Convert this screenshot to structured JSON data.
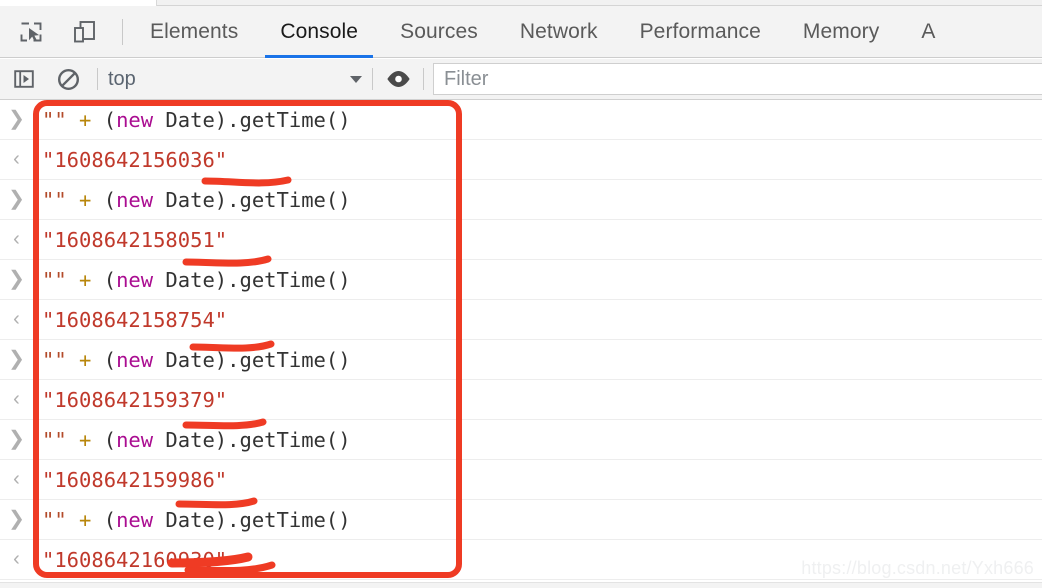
{
  "window": {
    "app": "Chrome DevTools",
    "theme_bg": "#f3f3f3",
    "accent": "#1a73e8",
    "annotation_color": "#ef3b24"
  },
  "toolbar": {
    "inspect_icon": "inspect-element-icon",
    "device_icon": "device-toolbar-icon",
    "tabs": [
      {
        "label": "Elements",
        "active": false
      },
      {
        "label": "Console",
        "active": true
      },
      {
        "label": "Sources",
        "active": false
      },
      {
        "label": "Network",
        "active": false
      },
      {
        "label": "Performance",
        "active": false
      },
      {
        "label": "Memory",
        "active": false
      },
      {
        "label": "A",
        "active": false
      }
    ]
  },
  "console_toolbar": {
    "sidebar_toggle_icon": "console-sidebar-toggle-icon",
    "clear_icon": "clear-console-icon",
    "context": {
      "value": "top",
      "chevron": "chevron-down-icon"
    },
    "eye_icon": "live-expression-eye-icon",
    "filter": {
      "value": "",
      "placeholder": "Filter"
    }
  },
  "console": {
    "input_marker": "❯",
    "output_marker": "‹",
    "entries": [
      {
        "type": "input",
        "expression": {
          "string": "\"\"",
          "plus": "+",
          "open_paren": "(",
          "keyword": "new",
          "rest": " Date).getTime()"
        }
      },
      {
        "type": "output",
        "value": "\"1608642156036\"",
        "number": "1608642156036"
      },
      {
        "type": "input",
        "expression": {
          "string": "\"\"",
          "plus": "+",
          "open_paren": "(",
          "keyword": "new",
          "rest": " Date).getTime()"
        }
      },
      {
        "type": "output",
        "value": "\"1608642158051\"",
        "number": "1608642158051"
      },
      {
        "type": "input",
        "expression": {
          "string": "\"\"",
          "plus": "+",
          "open_paren": "(",
          "keyword": "new",
          "rest": " Date).getTime()"
        }
      },
      {
        "type": "output",
        "value": "\"1608642158754\"",
        "number": "1608642158754"
      },
      {
        "type": "input",
        "expression": {
          "string": "\"\"",
          "plus": "+",
          "open_paren": "(",
          "keyword": "new",
          "rest": " Date).getTime()"
        }
      },
      {
        "type": "output",
        "value": "\"1608642159379\"",
        "number": "1608642159379"
      },
      {
        "type": "input",
        "expression": {
          "string": "\"\"",
          "plus": "+",
          "open_paren": "(",
          "keyword": "new",
          "rest": " Date).getTime()"
        }
      },
      {
        "type": "output",
        "value": "\"1608642159986\"",
        "number": "1608642159986"
      },
      {
        "type": "input",
        "expression": {
          "string": "\"\"",
          "plus": "+",
          "open_paren": "(",
          "keyword": "new",
          "rest": " Date).getTime()"
        }
      },
      {
        "type": "output",
        "value": "\"1608642160930\"",
        "number": "1608642160930"
      }
    ]
  },
  "watermark": {
    "text": "https://blog.csdn.net/Yxh666"
  }
}
